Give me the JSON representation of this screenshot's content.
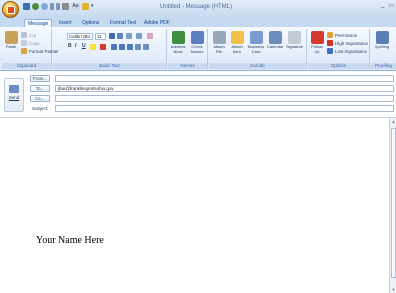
{
  "window": {
    "title": "Untitled - Message (HTML)",
    "controls": {
      "minimize": "_",
      "maximize": "▭"
    }
  },
  "quick_access": {
    "format_label": "Aa",
    "more": "▾"
  },
  "tabs": [
    "Message",
    "Insert",
    "Options",
    "Format Text",
    "Adobe PDF"
  ],
  "ribbon": {
    "clipboard": {
      "label": "Clipboard",
      "paste": "Paste",
      "cut": "Cut",
      "copy": "Copy",
      "format_painter": "Format Painter"
    },
    "basic_text": {
      "label": "Basic Text",
      "font_name": "Calibri (Bo",
      "font_size": "11",
      "bold": "B",
      "italic": "I",
      "underline": "U"
    },
    "names": {
      "label": "Names",
      "address_book": "Address Book",
      "check_names": "Check Names"
    },
    "include": {
      "label": "Include",
      "attach_file": "Attach File",
      "attach_item": "Attach Item",
      "business_card": "Business Card",
      "calendar": "Calendar",
      "signature": "Signature"
    },
    "options": {
      "label": "Options",
      "follow_up": "Follow Up",
      "permission": "Permission",
      "high_importance": "High Importance",
      "low_importance": "Low Importance"
    },
    "proofing": {
      "label": "Proofing",
      "spelling": "Spelling"
    }
  },
  "compose": {
    "send_label": "Send",
    "from_label": "From...",
    "to_label": "To...",
    "to_value": "jfan@franklinsportsohio.gov",
    "cc_label": "Cc...",
    "subject_label": "Subject:",
    "from_value": "",
    "cc_value": "",
    "subject_value": ""
  },
  "body": {
    "signature": "Your Name Here"
  }
}
